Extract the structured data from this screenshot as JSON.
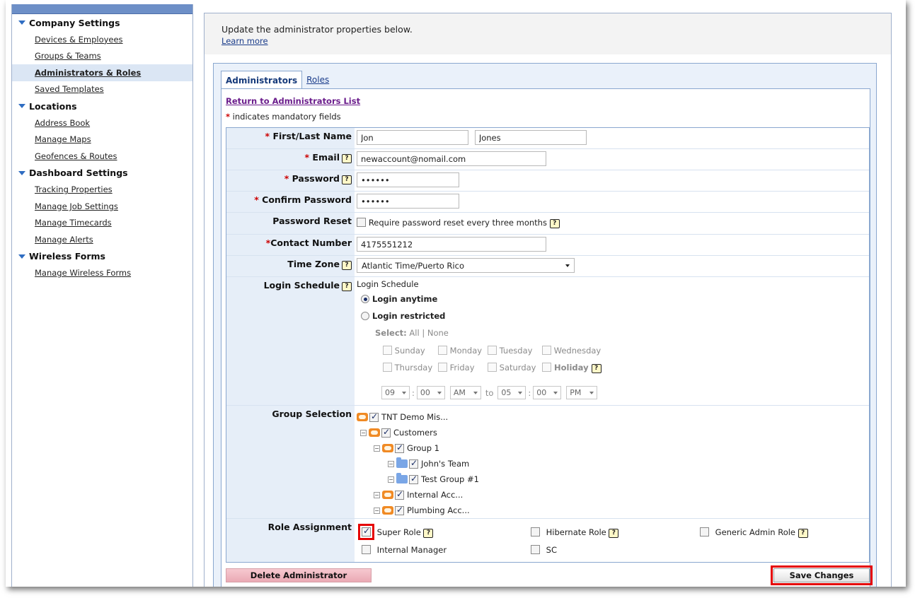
{
  "sidebar": {
    "sections": [
      {
        "title": "Company Settings",
        "items": [
          {
            "label": "Devices & Employees",
            "active": false
          },
          {
            "label": "Groups & Teams",
            "active": false
          },
          {
            "label": "Administrators & Roles",
            "active": true
          },
          {
            "label": "Saved Templates",
            "active": false
          }
        ]
      },
      {
        "title": "Locations",
        "items": [
          {
            "label": "Address Book",
            "active": false
          },
          {
            "label": "Manage Maps",
            "active": false
          },
          {
            "label": "Geofences & Routes",
            "active": false
          }
        ]
      },
      {
        "title": "Dashboard Settings",
        "items": [
          {
            "label": "Tracking Properties",
            "active": false
          },
          {
            "label": "Manage Job Settings",
            "active": false
          },
          {
            "label": "Manage Timecards",
            "active": false
          },
          {
            "label": "Manage Alerts",
            "active": false
          }
        ]
      },
      {
        "title": "Wireless Forms",
        "items": [
          {
            "label": "Manage Wireless Forms",
            "active": false
          }
        ]
      }
    ]
  },
  "header": {
    "intro": "Update the administrator properties below.",
    "learn_more": "Learn more"
  },
  "tabs": {
    "active": "Administrators",
    "other": "Roles"
  },
  "return_link": "Return to Administrators List",
  "mandatory_marker": "*",
  "mandatory_note": "indicates mandatory fields",
  "form": {
    "name_label": "First/Last Name",
    "first_name": "Jon",
    "last_name": "Jones",
    "email_label": "Email",
    "email": "newaccount@nomail.com",
    "password_label": "Password",
    "password": "••••••",
    "confirm_label": "Confirm Password",
    "confirm_password": "••••••",
    "reset_label": "Password Reset",
    "reset_checkbox": "Require password reset every three months",
    "contact_label": "Contact Number",
    "contact_number": "4175551212",
    "timezone_label": "Time Zone",
    "timezone": "Atlantic Time/Puerto Rico",
    "schedule_label": "Login Schedule",
    "schedule_heading": "Login Schedule",
    "login_anytime": "Login anytime",
    "login_restricted": "Login restricted",
    "select_label": "Select:",
    "select_all": "All",
    "select_sep": "|",
    "select_none": "None",
    "days": [
      "Sunday",
      "Monday",
      "Tuesday",
      "Wednesday",
      "Thursday",
      "Friday",
      "Saturday",
      "Holiday"
    ],
    "time_from": {
      "hour": "09",
      "minute": "00",
      "ampm": "AM"
    },
    "time_to_label": "to",
    "time_to": {
      "hour": "05",
      "minute": "00",
      "ampm": "PM"
    },
    "time_colon": ":",
    "group_label": "Group Selection",
    "groups": [
      {
        "label": "TNT Demo Mis...",
        "checked": true,
        "folder": "orange"
      },
      {
        "label": "Customers",
        "checked": true,
        "folder": "orange"
      },
      {
        "label": "Group 1",
        "checked": true,
        "folder": "orange"
      },
      {
        "label": "John's Team",
        "checked": true,
        "folder": "blue"
      },
      {
        "label": "Test Group #1",
        "checked": true,
        "folder": "blue"
      },
      {
        "label": "Internal Acc...",
        "checked": true,
        "folder": "orange"
      },
      {
        "label": "Plumbing Acc...",
        "checked": true,
        "folder": "orange"
      }
    ],
    "role_label": "Role Assignment",
    "roles": [
      {
        "label": "Super Role",
        "checked": true,
        "help": true
      },
      {
        "label": "Hibernate Role",
        "checked": false,
        "help": true
      },
      {
        "label": "Generic Admin Role",
        "checked": false,
        "help": true
      },
      {
        "label": "Internal Manager",
        "checked": false,
        "help": false
      },
      {
        "label": "SC",
        "checked": false,
        "help": false
      }
    ]
  },
  "buttons": {
    "delete": "Delete Administrator",
    "save": "Save Changes"
  },
  "colors": {
    "sidebar_bar": "#6d8fc7",
    "label_bg": "#e6eef8",
    "highlight": "#e50000",
    "delete_button": "#eaa9b4"
  }
}
